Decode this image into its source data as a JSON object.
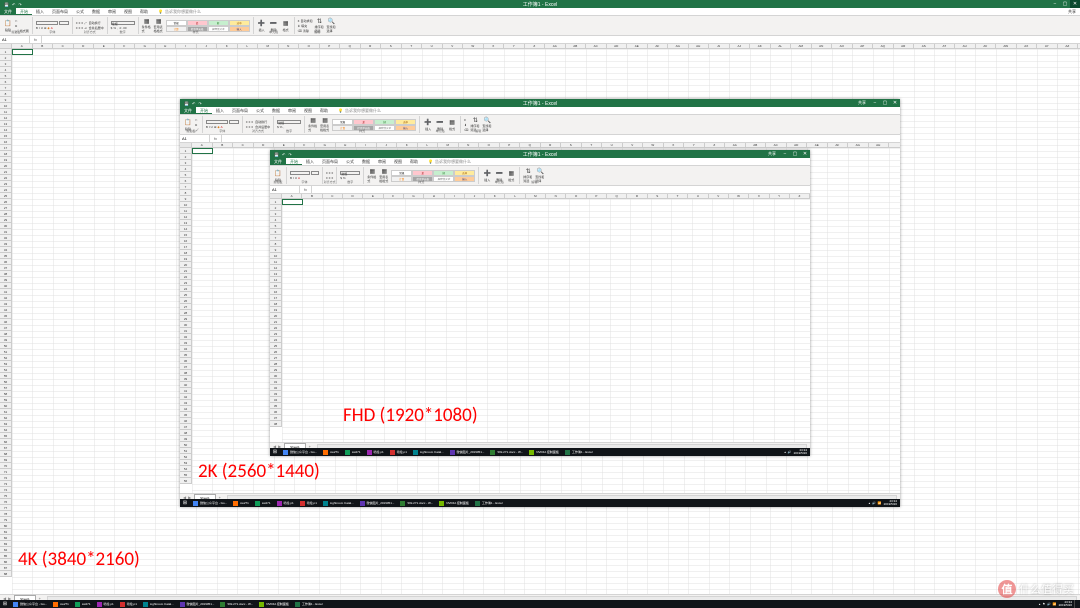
{
  "app_title": "工作簿1 - Excel",
  "ribbon": {
    "tabs": [
      "文件",
      "开始",
      "插入",
      "页面布局",
      "公式",
      "数据",
      "审阅",
      "视图",
      "帮助"
    ],
    "tellme": "告诉我你想要做什么",
    "share": "共享",
    "groups": {
      "clipboard": "剪贴板",
      "paste": "粘贴",
      "format_painter": "格式刷",
      "font": "字体",
      "alignment": "对齐方式",
      "wrap": "自动换行",
      "merge": "合并后居中",
      "number": "数字",
      "number_format": "常规",
      "cond_fmt": "条件格式",
      "table_fmt": "套用表格格式",
      "cell_styles_label": "单元格样式",
      "styles": "样式",
      "style_normal": "常规",
      "style_bad": "差",
      "style_good": "好",
      "style_neutral": "适中",
      "style_calc": "计算",
      "style_check": "检查单元格",
      "style_expl": "解释性文本",
      "style_input": "输入",
      "cells": "单元格",
      "insert": "插入",
      "delete": "删除",
      "format": "格式",
      "editing": "编辑",
      "autosum": "自动求和",
      "fill": "填充",
      "clear": "清除",
      "sort_filter": "排序和筛选",
      "find_select": "查找和选择"
    }
  },
  "formula_bar": {
    "namebox": "A1",
    "fx": "fx",
    "value": ""
  },
  "columns_4k": [
    "A",
    "B",
    "C",
    "D",
    "E",
    "F",
    "G",
    "H",
    "I",
    "J",
    "K",
    "L",
    "M",
    "N",
    "O",
    "P",
    "Q",
    "R",
    "S",
    "T",
    "U",
    "V",
    "W",
    "X",
    "Y",
    "Z",
    "AA",
    "AB",
    "AC",
    "AD",
    "AE",
    "AF",
    "AG",
    "AH",
    "AI",
    "AJ",
    "AK",
    "AL",
    "AM",
    "AN",
    "AO",
    "AP",
    "AQ",
    "AR",
    "AS",
    "AT",
    "AU",
    "AV",
    "AW",
    "AX",
    "AY",
    "AZ"
  ],
  "columns_2k": [
    "A",
    "B",
    "C",
    "D",
    "E",
    "F",
    "G",
    "H",
    "I",
    "J",
    "K",
    "L",
    "M",
    "N",
    "O",
    "P",
    "Q",
    "R",
    "S",
    "T",
    "U",
    "V",
    "W",
    "X",
    "Y",
    "Z",
    "AA",
    "AB",
    "AC",
    "AD",
    "AE",
    "AF",
    "AG",
    "AH"
  ],
  "columns_fhd": [
    "A",
    "B",
    "C",
    "D",
    "E",
    "F",
    "G",
    "H",
    "I",
    "J",
    "K",
    "L",
    "M",
    "N",
    "O",
    "P",
    "Q",
    "R",
    "S",
    "T",
    "U",
    "V",
    "W",
    "X",
    "Y",
    "Z"
  ],
  "sheet": {
    "name": "Sheet1",
    "add": "+"
  },
  "statusbar": {
    "ready": "就绪",
    "zoom": "100%",
    "minus": "−",
    "plus": "+"
  },
  "taskbar": {
    "items": [
      "微信公众平台 - Go...",
      "sw271",
      "sw271",
      "喷绘.p1",
      "喷绘.p1",
      "Lightroom Catal...",
      "微信图片_2019051...",
      "SW-271.docx - W...",
      "NVIDIA 控制面板",
      "工作簿1 - Excel"
    ],
    "clock_time": "23:34",
    "clock_date": "2019/5/20"
  },
  "labels": {
    "fhd": "FHD (1920*1080)",
    "k2": "2K (2560*1440)",
    "k4": "4K (3840*2160)"
  },
  "watermark": {
    "badge": "值",
    "text": "什么值得买"
  }
}
